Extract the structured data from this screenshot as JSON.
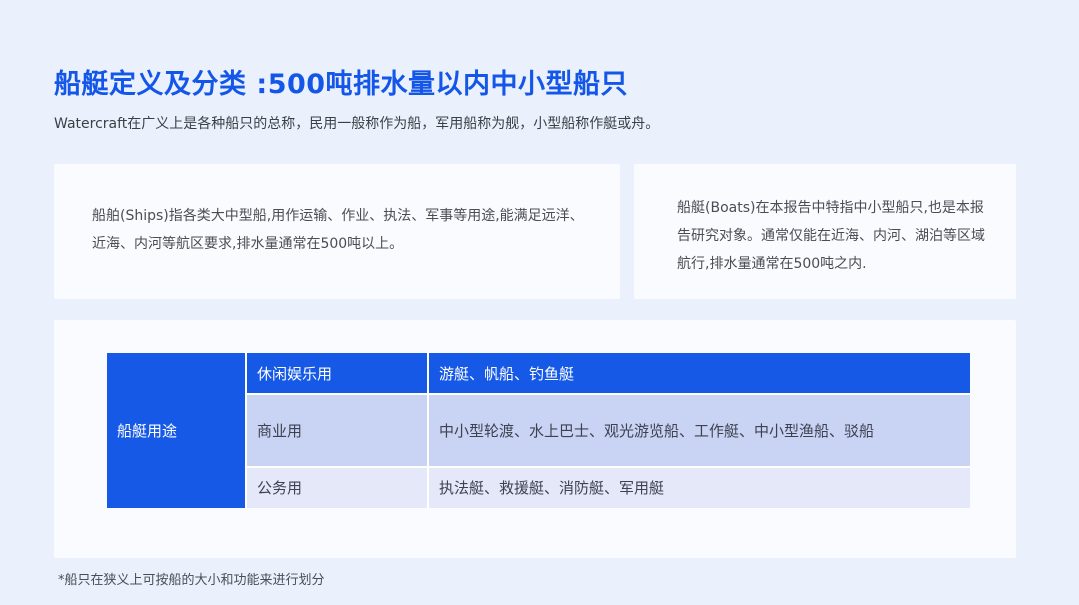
{
  "header": {
    "title": "船艇定义及分类 :500吨排水量以内中小型船只",
    "subtitle": "Watercraft在广义上是各种船只的总称，民用一般称作为船，军用船称为舰，小型船称作艇或舟。"
  },
  "definitions": {
    "ships": "船舶(Ships)指各类大中型船,用作运输、作业、执法、军事等用途,能满足远洋、近海、内河等航区要求,排水量通常在500吨以上。",
    "boats": "船艇(Boats)在本报告中特指中小型船只,也是本报告研究对象。通常仅能在近海、内河、湖泊等区域航行,排水量通常在500吨之内."
  },
  "usage_table": {
    "row_header": "船艇用途",
    "rows": [
      {
        "category": "休闲娱乐用",
        "examples": "游艇、帆船、钓鱼艇"
      },
      {
        "category": "商业用",
        "examples": "中小型轮渡、水上巴士、观光游览船、工作艇、中小型渔船、驳船"
      },
      {
        "category": "公务用",
        "examples": "执法艇、救援艇、消防艇、军用艇"
      }
    ]
  },
  "footnote": "*船只在狭义上可按船的大小和功能来进行划分"
}
